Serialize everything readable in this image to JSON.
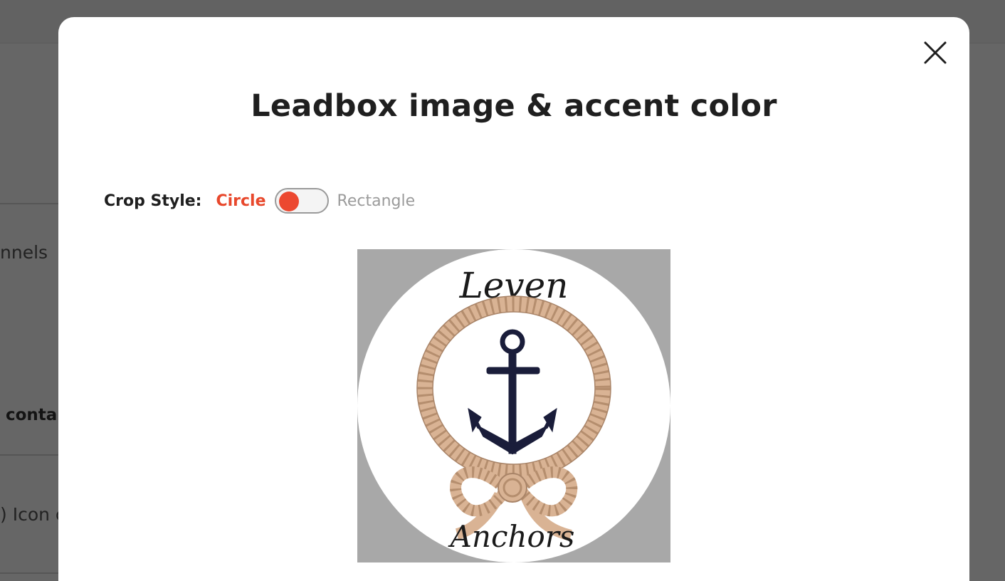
{
  "background": {
    "text_channels": "nnels",
    "text_contacts": "conta",
    "text_icon": ") Icon c"
  },
  "modal": {
    "title": "Leadbox image & accent color",
    "close_icon": "close-icon",
    "crop_style": {
      "label": "Crop Style:",
      "option_circle": "Circle",
      "option_rectangle": "Rectangle",
      "selected": "Circle"
    },
    "image": {
      "top_text": "Leven",
      "bottom_text": "Anchors"
    }
  },
  "colors": {
    "accent": "#ec4830",
    "overlay": "rgba(0,0,0,0.6)",
    "crop_background": "#a8a8a8",
    "anchor": "#1a1d3a",
    "rope": "#d9b394"
  }
}
